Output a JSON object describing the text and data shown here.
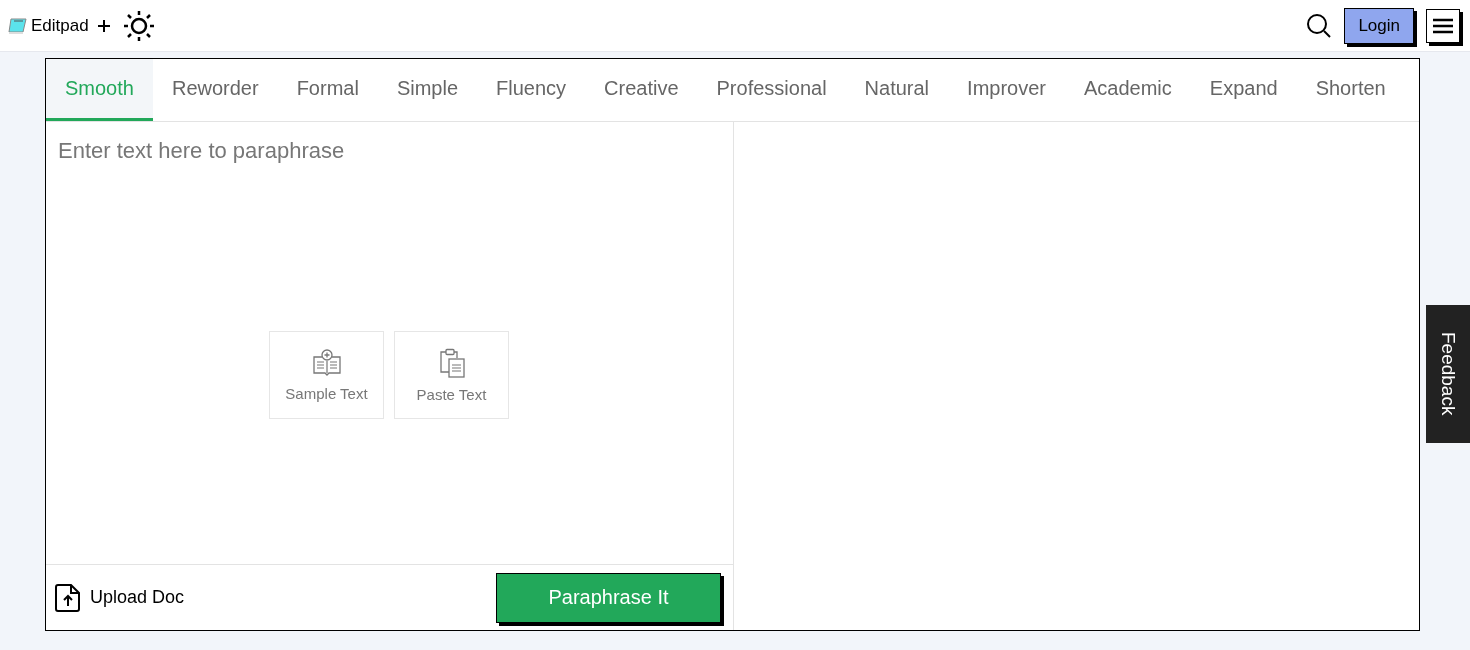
{
  "header": {
    "brand": "Editpad",
    "login": "Login"
  },
  "tabs": [
    {
      "label": "Smooth",
      "selected": true
    },
    {
      "label": "Reworder",
      "selected": false
    },
    {
      "label": "Formal",
      "selected": false
    },
    {
      "label": "Simple",
      "selected": false
    },
    {
      "label": "Fluency",
      "selected": false
    },
    {
      "label": "Creative",
      "selected": false
    },
    {
      "label": "Professional",
      "selected": false
    },
    {
      "label": "Natural",
      "selected": false
    },
    {
      "label": "Improver",
      "selected": false
    },
    {
      "label": "Academic",
      "selected": false
    },
    {
      "label": "Expand",
      "selected": false
    },
    {
      "label": "Shorten",
      "selected": false
    }
  ],
  "editor": {
    "placeholder": "Enter text here to paraphrase",
    "actions": [
      {
        "kind": "sample",
        "label": "Sample Text"
      },
      {
        "kind": "paste",
        "label": "Paste Text"
      }
    ],
    "upload": "Upload Doc",
    "submit": "Paraphrase It"
  },
  "feedback": "Feedback"
}
